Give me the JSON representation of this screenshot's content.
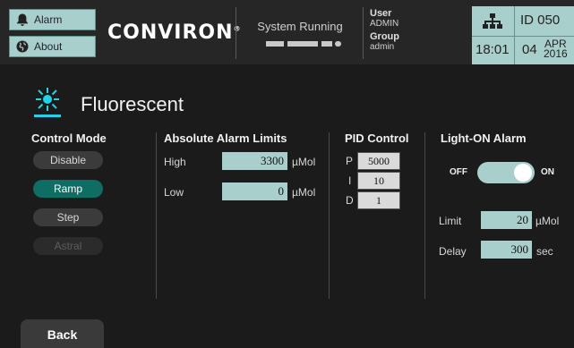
{
  "header": {
    "alarm_label": "Alarm",
    "about_label": "About",
    "brand": "CONVIRON",
    "brand_mark": "®",
    "status_text": "System Running",
    "user_label": "User",
    "user_value": "ADMIN",
    "group_label": "Group",
    "group_value": "admin",
    "id_text": "ID  050",
    "time": "18:01",
    "day": "04",
    "month": "APR",
    "year": "2016"
  },
  "page": {
    "title": "Fluorescent"
  },
  "control_mode": {
    "heading": "Control Mode",
    "options": [
      {
        "label": "Disable",
        "state": "normal"
      },
      {
        "label": "Ramp",
        "state": "active"
      },
      {
        "label": "Step",
        "state": "normal"
      },
      {
        "label": "Astral",
        "state": "disabled"
      }
    ]
  },
  "alarm_limits": {
    "heading": "Absolute Alarm Limits",
    "high_label": "High",
    "high_value": "3300",
    "low_label": "Low",
    "low_value": "0",
    "unit": "µMol"
  },
  "pid": {
    "heading": "PID Control",
    "p_label": "P",
    "p_value": "5000",
    "i_label": "I",
    "i_value": "10",
    "d_label": "D",
    "d_value": "1"
  },
  "light_on_alarm": {
    "heading": "Light-ON Alarm",
    "off_label": "OFF",
    "on_label": "ON",
    "enabled": true,
    "limit_label": "Limit",
    "limit_value": "20",
    "limit_unit": "µMol",
    "delay_label": "Delay",
    "delay_value": "300",
    "delay_unit": "sec"
  },
  "footer": {
    "back_label": "Back"
  },
  "colors": {
    "accent": "#a9cfcc",
    "active_pill": "#0f6d63",
    "light_icon": "#22d3e6",
    "background": "#1b1b1b"
  }
}
